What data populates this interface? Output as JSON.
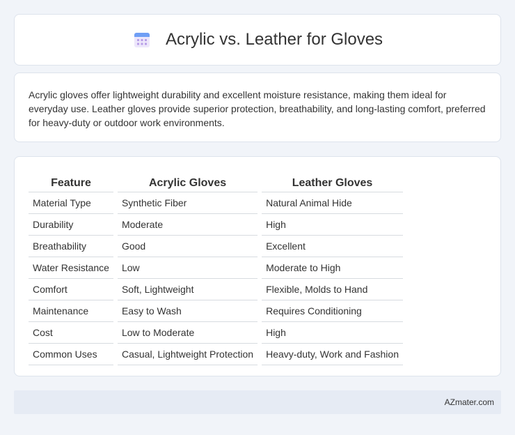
{
  "header": {
    "title": "Acrylic vs. Leather for Gloves",
    "icon": "calendar-icon",
    "icon_colors": {
      "top": "#6f9ef5",
      "body": "#ede7fb",
      "dots": "#b79de7"
    }
  },
  "intro": {
    "text": "Acrylic gloves offer lightweight durability and excellent moisture resistance, making them ideal for everyday use. Leather gloves provide superior protection, breathability, and long-lasting comfort, preferred for heavy-duty or outdoor work environments."
  },
  "table": {
    "headers": [
      "Feature",
      "Acrylic Gloves",
      "Leather Gloves"
    ],
    "rows": [
      [
        "Material Type",
        "Synthetic Fiber",
        "Natural Animal Hide"
      ],
      [
        "Durability",
        "Moderate",
        "High"
      ],
      [
        "Breathability",
        "Good",
        "Excellent"
      ],
      [
        "Water Resistance",
        "Low",
        "Moderate to High"
      ],
      [
        "Comfort",
        "Soft, Lightweight",
        "Flexible, Molds to Hand"
      ],
      [
        "Maintenance",
        "Easy to Wash",
        "Requires Conditioning"
      ],
      [
        "Cost",
        "Low to Moderate",
        "High"
      ],
      [
        "Common Uses",
        "Casual, Lightweight Protection",
        "Heavy-duty, Work and Fashion"
      ]
    ]
  },
  "footer": {
    "text": "AZmater.com"
  }
}
